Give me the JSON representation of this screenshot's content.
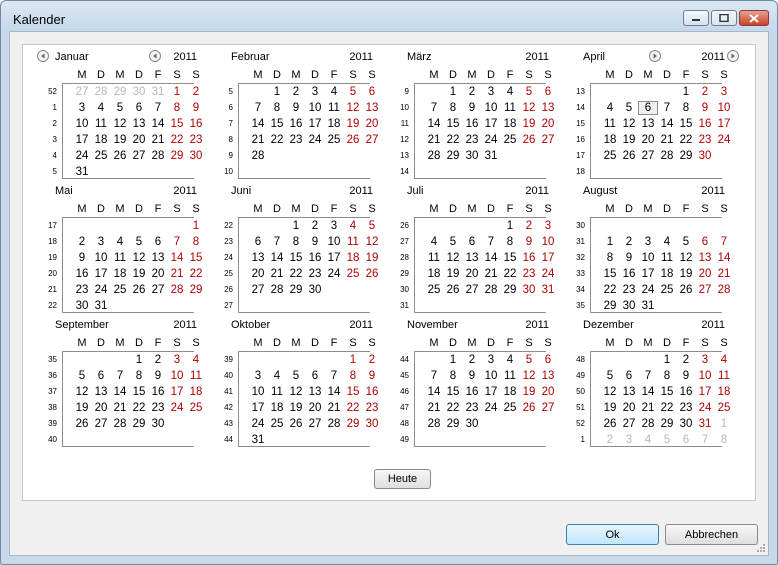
{
  "window": {
    "title": "Kalender"
  },
  "weekdays": [
    "M",
    "D",
    "M",
    "D",
    "F",
    "S",
    "S"
  ],
  "year": "2011",
  "months": [
    {
      "name": "Januar",
      "weeks": [
        "52",
        "1",
        "2",
        "3",
        "4",
        "5"
      ],
      "rows": [
        [
          "27",
          "28",
          "29",
          "30",
          "31",
          "1",
          "2"
        ],
        [
          "3",
          "4",
          "5",
          "6",
          "7",
          "8",
          "9"
        ],
        [
          "10",
          "11",
          "12",
          "13",
          "14",
          "15",
          "16"
        ],
        [
          "17",
          "18",
          "19",
          "20",
          "21",
          "22",
          "23"
        ],
        [
          "24",
          "25",
          "26",
          "27",
          "28",
          "29",
          "30"
        ],
        [
          "31",
          "",
          "",
          "",
          "",
          "",
          ""
        ]
      ],
      "other_prefix": 5,
      "other_suffix_row": -1
    },
    {
      "name": "Februar",
      "weeks": [
        "5",
        "6",
        "7",
        "8",
        "9",
        "10"
      ],
      "rows": [
        [
          "",
          "1",
          "2",
          "3",
          "4",
          "5",
          "6"
        ],
        [
          "7",
          "8",
          "9",
          "10",
          "11",
          "12",
          "13"
        ],
        [
          "14",
          "15",
          "16",
          "17",
          "18",
          "19",
          "20"
        ],
        [
          "21",
          "22",
          "23",
          "24",
          "25",
          "26",
          "27"
        ],
        [
          "28",
          "",
          "",
          "",
          "",
          "",
          ""
        ],
        [
          "",
          "",
          "",
          "",
          "",
          "",
          ""
        ]
      ]
    },
    {
      "name": "März",
      "weeks": [
        "9",
        "10",
        "11",
        "12",
        "13",
        "14"
      ],
      "rows": [
        [
          "",
          "1",
          "2",
          "3",
          "4",
          "5",
          "6"
        ],
        [
          "7",
          "8",
          "9",
          "10",
          "11",
          "12",
          "13"
        ],
        [
          "14",
          "15",
          "16",
          "17",
          "18",
          "19",
          "20"
        ],
        [
          "21",
          "22",
          "23",
          "24",
          "25",
          "26",
          "27"
        ],
        [
          "28",
          "29",
          "30",
          "31",
          "",
          "",
          ""
        ],
        [
          "",
          "",
          "",
          "",
          "",
          "",
          ""
        ]
      ]
    },
    {
      "name": "April",
      "weeks": [
        "13",
        "14",
        "15",
        "16",
        "17",
        "18"
      ],
      "rows": [
        [
          "",
          "",
          "",
          "",
          "1",
          "2",
          "3"
        ],
        [
          "4",
          "5",
          "6",
          "7",
          "8",
          "9",
          "10"
        ],
        [
          "11",
          "12",
          "13",
          "14",
          "15",
          "16",
          "17"
        ],
        [
          "18",
          "19",
          "20",
          "21",
          "22",
          "23",
          "24"
        ],
        [
          "25",
          "26",
          "27",
          "28",
          "29",
          "30",
          ""
        ],
        [
          "",
          "",
          "",
          "",
          "",
          "",
          ""
        ]
      ]
    },
    {
      "name": "Mai",
      "weeks": [
        "17",
        "18",
        "19",
        "20",
        "21",
        "22"
      ],
      "rows": [
        [
          "",
          "",
          "",
          "",
          "",
          "",
          "1"
        ],
        [
          "2",
          "3",
          "4",
          "5",
          "6",
          "7",
          "8"
        ],
        [
          "9",
          "10",
          "11",
          "12",
          "13",
          "14",
          "15"
        ],
        [
          "16",
          "17",
          "18",
          "19",
          "20",
          "21",
          "22"
        ],
        [
          "23",
          "24",
          "25",
          "26",
          "27",
          "28",
          "29"
        ],
        [
          "30",
          "31",
          "",
          "",
          "",
          "",
          ""
        ]
      ]
    },
    {
      "name": "Juni",
      "weeks": [
        "22",
        "23",
        "24",
        "25",
        "26",
        "27"
      ],
      "rows": [
        [
          "",
          "",
          "1",
          "2",
          "3",
          "4",
          "5"
        ],
        [
          "6",
          "7",
          "8",
          "9",
          "10",
          "11",
          "12"
        ],
        [
          "13",
          "14",
          "15",
          "16",
          "17",
          "18",
          "19"
        ],
        [
          "20",
          "21",
          "22",
          "23",
          "24",
          "25",
          "26"
        ],
        [
          "27",
          "28",
          "29",
          "30",
          "",
          "",
          ""
        ],
        [
          "",
          "",
          "",
          "",
          "",
          "",
          ""
        ]
      ]
    },
    {
      "name": "Juli",
      "weeks": [
        "26",
        "27",
        "28",
        "29",
        "30",
        "31"
      ],
      "rows": [
        [
          "",
          "",
          "",
          "",
          "1",
          "2",
          "3"
        ],
        [
          "4",
          "5",
          "6",
          "7",
          "8",
          "9",
          "10"
        ],
        [
          "11",
          "12",
          "13",
          "14",
          "15",
          "16",
          "17"
        ],
        [
          "18",
          "19",
          "20",
          "21",
          "22",
          "23",
          "24"
        ],
        [
          "25",
          "26",
          "27",
          "28",
          "29",
          "30",
          "31"
        ],
        [
          "",
          "",
          "",
          "",
          "",
          "",
          ""
        ]
      ]
    },
    {
      "name": "August",
      "weeks": [
        "30",
        "31",
        "32",
        "33",
        "34",
        "35"
      ],
      "rows": [
        [
          "",
          "",
          "",
          "",
          "",
          "",
          ""
        ],
        [
          "1",
          "2",
          "3",
          "4",
          "5",
          "6",
          "7"
        ],
        [
          "8",
          "9",
          "10",
          "11",
          "12",
          "13",
          "14"
        ],
        [
          "15",
          "16",
          "17",
          "18",
          "19",
          "20",
          "21"
        ],
        [
          "22",
          "23",
          "24",
          "25",
          "26",
          "27",
          "28"
        ],
        [
          "29",
          "30",
          "31",
          "",
          "",
          "",
          ""
        ]
      ]
    },
    {
      "name": "September",
      "weeks": [
        "35",
        "36",
        "37",
        "38",
        "39",
        "40"
      ],
      "rows": [
        [
          "",
          "",
          "",
          "1",
          "2",
          "3",
          "4"
        ],
        [
          "5",
          "6",
          "7",
          "8",
          "9",
          "10",
          "11"
        ],
        [
          "12",
          "13",
          "14",
          "15",
          "16",
          "17",
          "18"
        ],
        [
          "19",
          "20",
          "21",
          "22",
          "23",
          "24",
          "25"
        ],
        [
          "26",
          "27",
          "28",
          "29",
          "30",
          "",
          ""
        ],
        [
          "",
          "",
          "",
          "",
          "",
          "",
          ""
        ]
      ]
    },
    {
      "name": "Oktober",
      "weeks": [
        "39",
        "40",
        "41",
        "42",
        "43",
        "44"
      ],
      "rows": [
        [
          "",
          "",
          "",
          "",
          "",
          "1",
          "2"
        ],
        [
          "3",
          "4",
          "5",
          "6",
          "7",
          "8",
          "9"
        ],
        [
          "10",
          "11",
          "12",
          "13",
          "14",
          "15",
          "16"
        ],
        [
          "17",
          "18",
          "19",
          "20",
          "21",
          "22",
          "23"
        ],
        [
          "24",
          "25",
          "26",
          "27",
          "28",
          "29",
          "30"
        ],
        [
          "31",
          "",
          "",
          "",
          "",
          "",
          ""
        ]
      ]
    },
    {
      "name": "November",
      "weeks": [
        "44",
        "45",
        "46",
        "47",
        "48",
        "49"
      ],
      "rows": [
        [
          "",
          "1",
          "2",
          "3",
          "4",
          "5",
          "6"
        ],
        [
          "7",
          "8",
          "9",
          "10",
          "11",
          "12",
          "13"
        ],
        [
          "14",
          "15",
          "16",
          "17",
          "18",
          "19",
          "20"
        ],
        [
          "21",
          "22",
          "23",
          "24",
          "25",
          "26",
          "27"
        ],
        [
          "28",
          "29",
          "30",
          "",
          "",
          "",
          ""
        ],
        [
          "",
          "",
          "",
          "",
          "",
          "",
          ""
        ]
      ]
    },
    {
      "name": "Dezember",
      "weeks": [
        "48",
        "49",
        "50",
        "51",
        "52",
        "1"
      ],
      "rows": [
        [
          "",
          "",
          "",
          "1",
          "2",
          "3",
          "4"
        ],
        [
          "5",
          "6",
          "7",
          "8",
          "9",
          "10",
          "11"
        ],
        [
          "12",
          "13",
          "14",
          "15",
          "16",
          "17",
          "18"
        ],
        [
          "19",
          "20",
          "21",
          "22",
          "23",
          "24",
          "25"
        ],
        [
          "26",
          "27",
          "28",
          "29",
          "30",
          "31",
          "1"
        ],
        [
          "2",
          "3",
          "4",
          "5",
          "6",
          "7",
          "8"
        ]
      ]
    }
  ],
  "today": {
    "month": "April",
    "day": "6"
  },
  "buttons": {
    "today": "Heute",
    "ok": "Ok",
    "cancel": "Abbrechen"
  },
  "colors": {
    "weekend": "#b00000",
    "other_month": "#b8b8b8"
  }
}
